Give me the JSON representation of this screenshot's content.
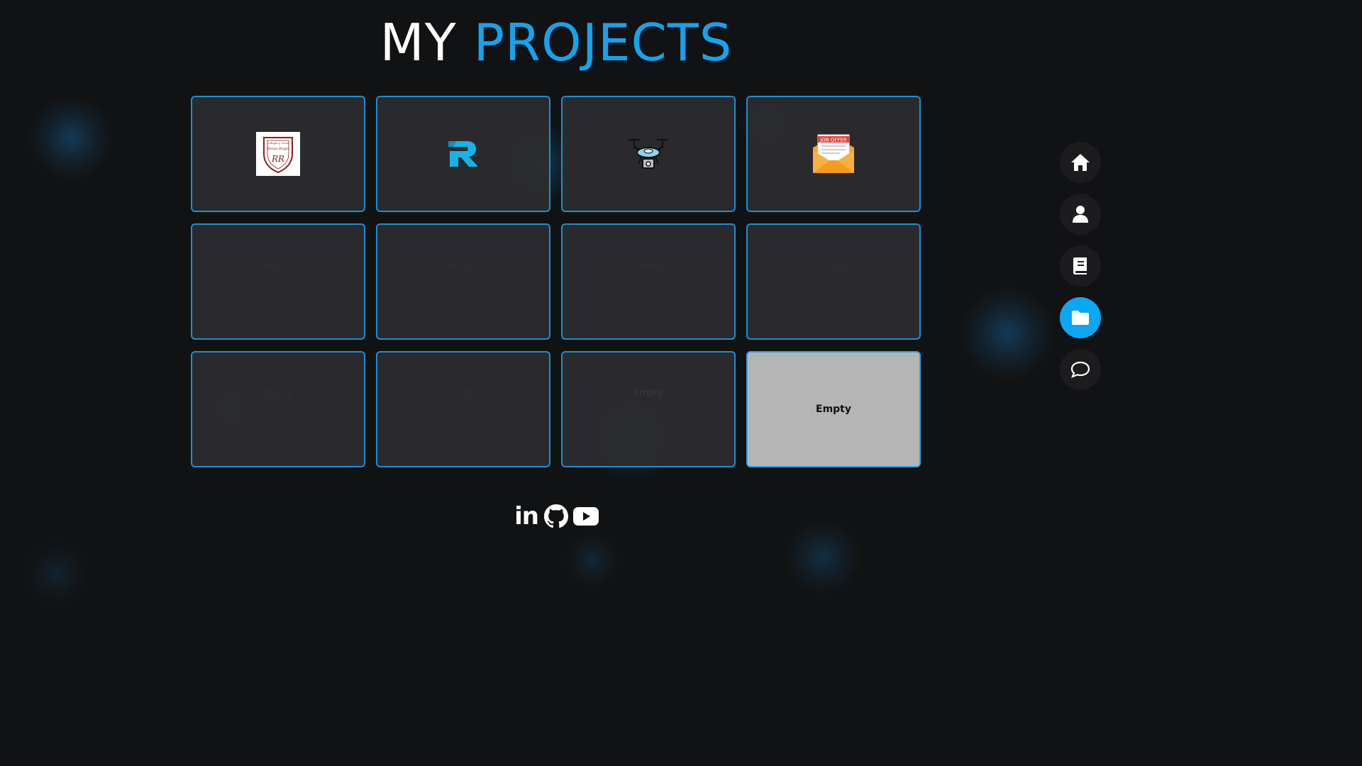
{
  "header": {
    "title_prefix": "MY",
    "title_accent": "PROJECTS"
  },
  "colors": {
    "accent": "#15a3ee",
    "background": "#111213",
    "card_border": "#1a8fd6",
    "active_nav": "#0ba7f2"
  },
  "projects": [
    {
      "name": "school-crest",
      "icon": "school-crest-logo",
      "text": "Colegio y Liceo Reina Regis"
    },
    {
      "name": "r-logo",
      "icon": "r-logo"
    },
    {
      "name": "drone",
      "icon": "drone-icon"
    },
    {
      "name": "job-offer",
      "icon": "job-offer-envelope-icon",
      "text": "JOB OFFER"
    },
    {
      "name": "empty-5",
      "label": "Empty"
    },
    {
      "name": "empty-6",
      "label": "Empty"
    },
    {
      "name": "empty-7",
      "label": "Empty"
    },
    {
      "name": "empty-8",
      "label": "Empty"
    },
    {
      "name": "empty-9",
      "label": "Empty"
    },
    {
      "name": "empty-10",
      "label": "Empty"
    },
    {
      "name": "empty-11",
      "label": "Empty"
    },
    {
      "name": "empty-12",
      "label": "Empty",
      "state": "hovered"
    }
  ],
  "side_nav": [
    {
      "icon": "home-icon"
    },
    {
      "icon": "user-icon"
    },
    {
      "icon": "book-icon"
    },
    {
      "icon": "folder-icon",
      "active": true
    },
    {
      "icon": "chat-icon"
    }
  ],
  "social": {
    "linkedin_text": "in",
    "icons": [
      "linkedin-icon",
      "github-icon",
      "youtube-icon"
    ]
  }
}
